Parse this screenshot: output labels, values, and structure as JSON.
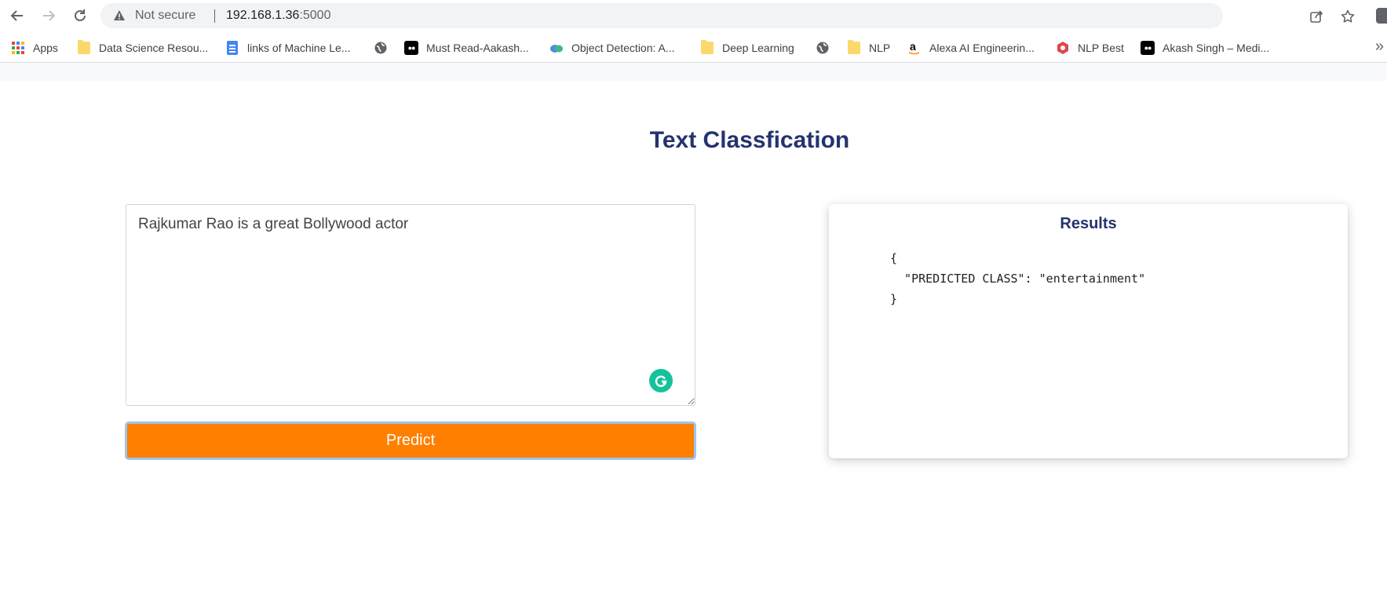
{
  "browser": {
    "security_status": "Not secure",
    "url_host": "192.168.1.36",
    "url_port": ":5000",
    "bookmarks": [
      {
        "label": "Apps",
        "icon": "apps-grid-icon"
      },
      {
        "label": "Data Science Resou...",
        "icon": "folder-icon"
      },
      {
        "label": "links of Machine Le...",
        "icon": "google-docs-icon"
      },
      {
        "label": "",
        "icon": "globe-icon"
      },
      {
        "label": "Must Read-Aakash...",
        "icon": "medium-icon"
      },
      {
        "label": "Object Detection: A...",
        "icon": "cloud-icon"
      },
      {
        "label": "Deep Learning",
        "icon": "folder-icon"
      },
      {
        "label": "",
        "icon": "globe-icon"
      },
      {
        "label": "NLP",
        "icon": "folder-icon"
      },
      {
        "label": "Alexa AI Engineerin...",
        "icon": "amazon-icon"
      },
      {
        "label": "NLP Best",
        "icon": "red-shield-icon"
      },
      {
        "label": "Akash Singh – Medi...",
        "icon": "medium-icon"
      }
    ],
    "overflow": "»"
  },
  "page": {
    "title": "Text Classfication",
    "input_text": "Rajkumar Rao is a great Bollywood actor",
    "predict_label": "Predict",
    "results_title": "Results",
    "results_json": "{\n  \"PREDICTED CLASS\": \"entertainment\"\n}"
  },
  "colors": {
    "title": "#24336f",
    "predict_button": "#ff7f00",
    "grammarly": "#15c39a"
  }
}
